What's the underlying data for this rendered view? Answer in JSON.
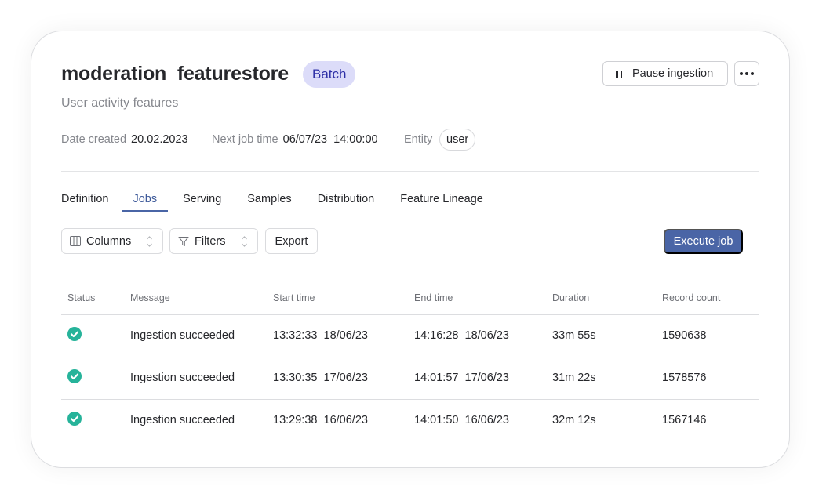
{
  "header": {
    "title": "moderation_featurestore",
    "type_badge": "Batch",
    "subtitle": "User activity features",
    "pause_button_label": "Pause ingestion",
    "more_button_icon": "more-horizontal-icon"
  },
  "meta": {
    "date_created_label": "Date created",
    "date_created_value": "20.02.2023",
    "next_job_label": "Next job time",
    "next_job_date": "06/07/23",
    "next_job_time": "14:00:00",
    "entity_label": "Entity",
    "entity_value": "user"
  },
  "tabs": [
    {
      "label": "Definition",
      "active": false
    },
    {
      "label": "Jobs",
      "active": true
    },
    {
      "label": "Serving",
      "active": false
    },
    {
      "label": "Samples",
      "active": false
    },
    {
      "label": "Distribution",
      "active": false
    },
    {
      "label": "Feature Lineage",
      "active": false
    }
  ],
  "toolbar": {
    "columns_label": "Columns",
    "filters_label": "Filters",
    "export_label": "Export",
    "execute_label": "Execute job"
  },
  "colors": {
    "accent": "#4a65a6",
    "success": "#26b39a",
    "badge_bg": "#dcdcf9",
    "badge_text": "#2d2fa6"
  },
  "table": {
    "columns": [
      "Status",
      "Message",
      "Start time",
      "End time",
      "Duration",
      "Record count"
    ],
    "rows": [
      {
        "status": "success",
        "message": "Ingestion succeeded",
        "start_time": "13:32:33",
        "start_date": "18/06/23",
        "end_time": "14:16:28",
        "end_date": "18/06/23",
        "duration": "33m 55s",
        "record_count": "1590638"
      },
      {
        "status": "success",
        "message": "Ingestion succeeded",
        "start_time": "13:30:35",
        "start_date": "17/06/23",
        "end_time": "14:01:57",
        "end_date": "17/06/23",
        "duration": "31m 22s",
        "record_count": "1578576"
      },
      {
        "status": "success",
        "message": "Ingestion succeeded",
        "start_time": "13:29:38",
        "start_date": "16/06/23",
        "end_time": "14:01:50",
        "end_date": "16/06/23",
        "duration": "32m 12s",
        "record_count": "1567146"
      }
    ]
  }
}
